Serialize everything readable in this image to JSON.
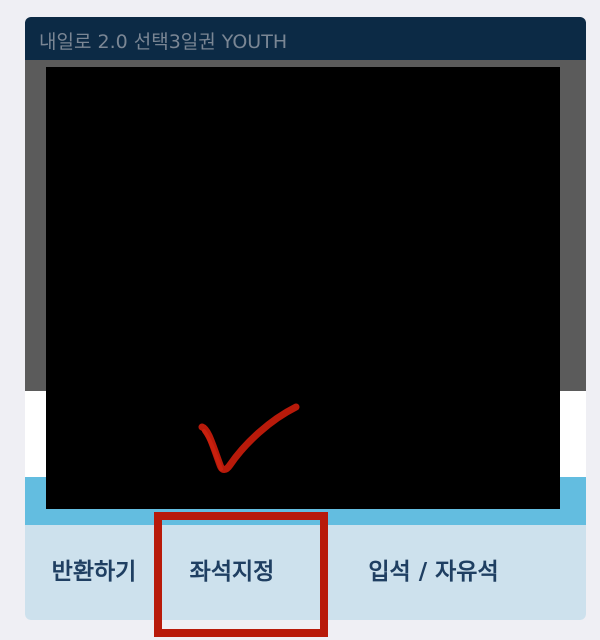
{
  "ticket": {
    "title": "내일로 2.0 선택3일권 YOUTH"
  },
  "actions": {
    "return_label": "반환하기",
    "seat_label": "좌석지정",
    "standing_label": "입석 / 자유석"
  },
  "annotation": {
    "highlight_color": "#b81a0a",
    "check_icon": "checkmark-icon"
  },
  "colors": {
    "header": "#0c2a45",
    "accent_stripe": "#63bde0",
    "button_bar": "#cde1ed",
    "button_text": "#1f3f62"
  }
}
